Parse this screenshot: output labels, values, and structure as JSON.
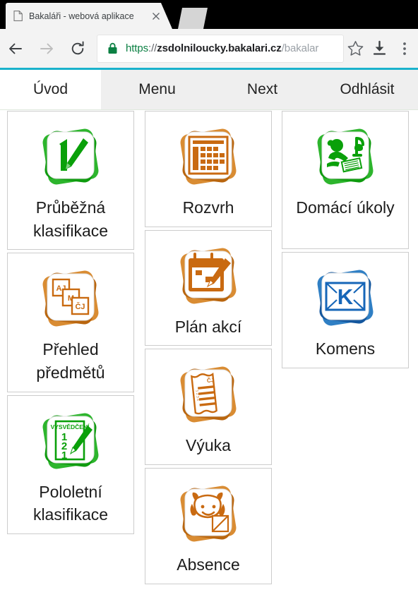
{
  "browser": {
    "tab": {
      "title": "Bakaláři - webová aplikace",
      "favicon": "page-icon",
      "close": "close-icon"
    },
    "toolbar": {
      "back": "back-arrow-icon",
      "forward": "forward-arrow-icon",
      "reload": "reload-icon",
      "bookmark": "star-icon",
      "download": "download-icon",
      "menu": "three-dot-menu-icon",
      "lock": "lock-icon"
    },
    "url": {
      "scheme": "https",
      "separator": "://",
      "host": "zsdolniloucky.bakalari.cz",
      "path": "/bakalar",
      "full": "https://zsdolniloucky.bakalari.cz/bakalar"
    }
  },
  "navbar": {
    "accent_color": "#1ab2cc",
    "tabs": [
      {
        "label": "Úvod",
        "active": true
      },
      {
        "label": "Menu",
        "active": false
      },
      {
        "label": "Next",
        "active": false
      },
      {
        "label": "Odhlásit",
        "active": false
      }
    ]
  },
  "colors": {
    "green": "#0aa00a",
    "orange": "#c96a11",
    "blue": "#1666b8",
    "tile_border": "#cccccc",
    "navbar_bg": "#efefef"
  },
  "columns": [
    {
      "tiles": [
        {
          "label": "Průběžná klasifikace",
          "icon": "grade-one-pencil-icon",
          "color": "#0aa00a",
          "tall": true
        },
        {
          "label": "Přehled předmětů",
          "icon": "subject-cards-icon",
          "color": "#c96a11",
          "tall": true,
          "card_labels": [
            "AJ",
            "M",
            "ČJ"
          ]
        },
        {
          "label": "Pololetní klasifikace",
          "icon": "report-card-icon",
          "color": "#0aa00a",
          "tall": true,
          "certificate_title": "VYSVĚDČENÍ",
          "certificate_grades": [
            "1",
            "2",
            "1"
          ]
        }
      ]
    },
    {
      "tiles": [
        {
          "label": "Rozvrh",
          "icon": "timetable-icon",
          "color": "#c96a11",
          "tall": false
        },
        {
          "label": "Plán akcí",
          "icon": "calendar-pencil-icon",
          "color": "#c96a11",
          "tall": false
        },
        {
          "label": "Výuka",
          "icon": "lesson-document-icon",
          "color": "#c96a11",
          "tall": false,
          "doc_label": "ČJ"
        },
        {
          "label": "Absence",
          "icon": "pupil-face-icon",
          "color": "#c96a11",
          "tall": false
        }
      ]
    },
    {
      "tiles": [
        {
          "label": "Domácí úkoly",
          "icon": "homework-desk-icon",
          "color": "#0aa00a",
          "tall": true
        },
        {
          "label": "Komens",
          "icon": "envelope-k-icon",
          "color": "#1666b8",
          "tall": false
        }
      ]
    }
  ]
}
